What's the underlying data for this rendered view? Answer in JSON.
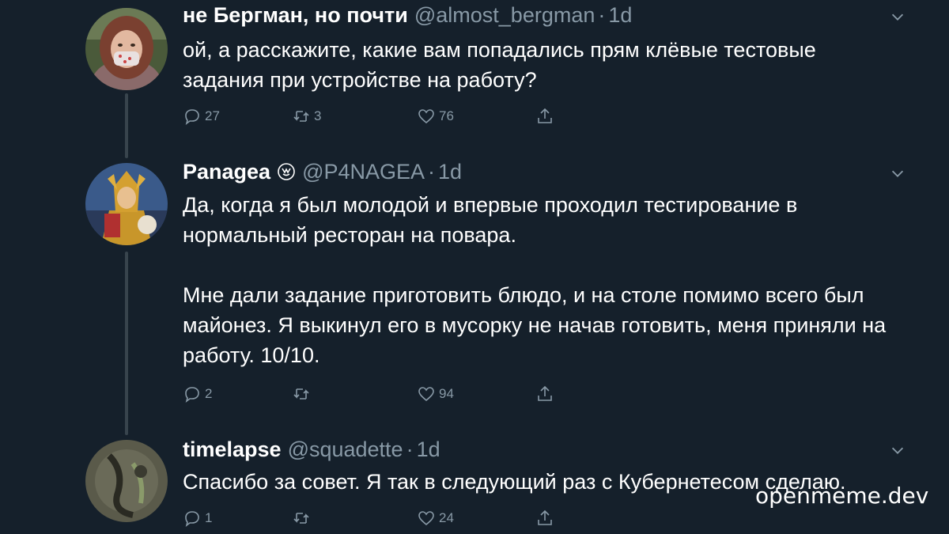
{
  "theme": {
    "background": "#15202b",
    "muted": "#8899a6",
    "thread_line": "#38444d"
  },
  "tweets": [
    {
      "display_name": "не Бергман, но почти",
      "handle": "@almost_bergman",
      "separator": "·",
      "time": "1d",
      "verified": false,
      "text": [
        "ой, а расскажите, какие вам попадались прям клёвые тестовые задания при устройстве на работу?"
      ],
      "replies": "27",
      "retweets": "3",
      "likes": "76"
    },
    {
      "display_name": "Panagea",
      "handle": "@P4NAGEA",
      "separator": "·",
      "time": "1d",
      "verified": true,
      "text": [
        "Да, когда я был молодой и впервые проходил тестирование в нормальный ресторан на повара.",
        "Мне дали задание приготовить блюдо, и на столе помимо всего был майонез. Я выкинул его в мусорку не начав готовить, меня приняли на работу. 10/10."
      ],
      "replies": "2",
      "retweets": "",
      "likes": "94"
    },
    {
      "display_name": "timelapse",
      "handle": "@squadette",
      "separator": "·",
      "time": "1d",
      "verified": false,
      "text": [
        "Спасибо за совет. Я так в следующий раз с Кубернетесом сделаю."
      ],
      "replies": "1",
      "retweets": "",
      "likes": "24"
    }
  ],
  "watermark": "openmeme.dev"
}
